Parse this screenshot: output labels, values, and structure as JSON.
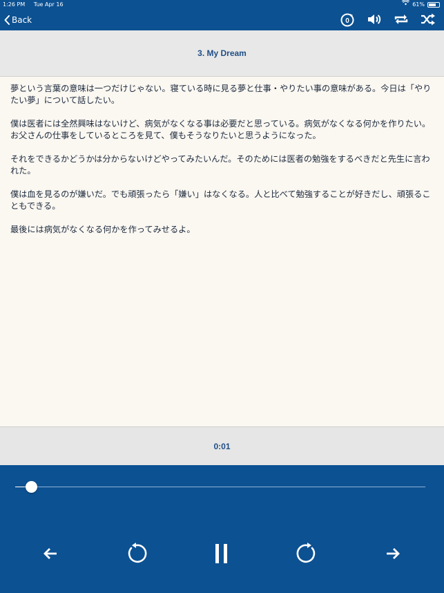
{
  "status_bar": {
    "time": "1:26 PM",
    "date": "Tue Apr 16",
    "battery": "61%",
    "battery_level": 0.61
  },
  "nav": {
    "back_label": "Back",
    "icons": [
      "sleep-timer-icon",
      "volume-icon",
      "repeat-icon",
      "shuffle-icon"
    ],
    "timer_badge": "0"
  },
  "lesson": {
    "title": "3. My Dream"
  },
  "transcript": [
    "夢という言葉の意味は一つだけじゃない。寝ている時に見る夢と仕事・やりたい事の意味がある。今日は「やりたい夢」について話したい。",
    "僕は医者には全然興味はないけど、病気がなくなる事は必要だと思っている。病気がなくなる何かを作りたい。お父さんの仕事をしているところを見て、僕もそうなりたいと思うようになった。",
    "それをできるかどうかは分からないけどやってみたいんだ。そのためには医者の勉強をするべきだと先生に言われた。",
    "僕は血を見るのが嫌いだ。でも頑張ったら「嫌い」はなくなる。人と比べて勉強することが好きだし、頑張ることもできる。",
    "最後には病気がなくなる何かを作ってみせるよ。"
  ],
  "player": {
    "elapsed": "0:01",
    "progress": 0.04,
    "controls": [
      "previous-arrow-icon",
      "rewind-icon",
      "pause-icon",
      "forward-icon",
      "next-arrow-icon"
    ]
  },
  "colors": {
    "accent": "#0c5192",
    "title_text": "#1f4e86",
    "page_bg": "#fbf7f1",
    "panel_bg": "#e8e8e8"
  }
}
